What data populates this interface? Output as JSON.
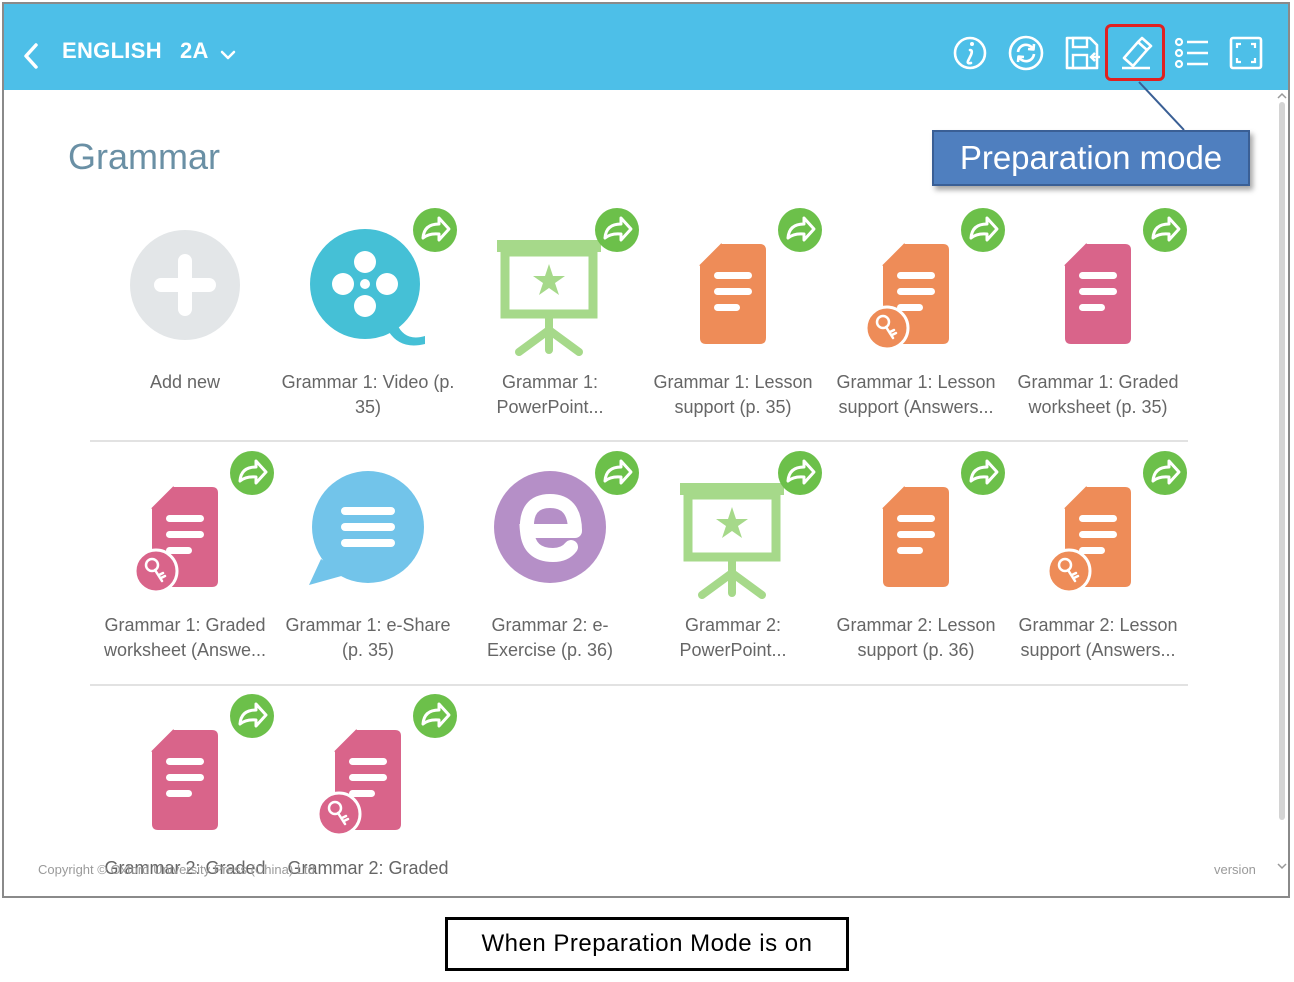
{
  "topbar": {
    "back_icon": "chevron-left-icon",
    "subject": "ENGLISH",
    "grade": "2A",
    "grade_dropdown_icon": "chevron-down-icon",
    "icons": [
      "info-icon",
      "sync-icon",
      "save-icon",
      "preparation-mode-icon",
      "list-icon",
      "fullscreen-icon"
    ],
    "background_color": "#4dbfe8"
  },
  "callout": {
    "text": "Preparation mode",
    "color": "#4f7fbf",
    "highlight_color": "#e02020"
  },
  "section": {
    "title": "Grammar"
  },
  "tiles": [
    {
      "label": "Add new",
      "icon": "add-icon",
      "share": false,
      "key": false
    },
    {
      "label": "Grammar 1: Video (p. 35)",
      "icon": "video-reel-icon",
      "share": true,
      "key": false
    },
    {
      "label": "Grammar 1: PowerPoint...",
      "icon": "presentation-icon",
      "share": true,
      "key": false
    },
    {
      "label": "Grammar 1: Lesson support (p. 35)",
      "icon": "document-icon",
      "share": true,
      "key": false
    },
    {
      "label": "Grammar 1: Lesson support (Answers...",
      "icon": "document-icon",
      "share": true,
      "key": true
    },
    {
      "label": "Grammar 1: Graded worksheet (p. 35)",
      "icon": "document-icon",
      "share": true,
      "key": false
    },
    {
      "label": "Grammar 1: Graded worksheet (Answe...",
      "icon": "document-icon",
      "share": true,
      "key": true
    },
    {
      "label": "Grammar 1: e-Share (p. 35)",
      "icon": "speech-bubble-icon",
      "share": false,
      "key": false
    },
    {
      "label": "Grammar 2: e-Exercise (p. 36)",
      "icon": "e-exercise-icon",
      "share": true,
      "key": false
    },
    {
      "label": "Grammar 2: PowerPoint...",
      "icon": "presentation-icon",
      "share": true,
      "key": false
    },
    {
      "label": "Grammar 2: Lesson support (p. 36)",
      "icon": "document-icon",
      "share": true,
      "key": false
    },
    {
      "label": "Grammar 2: Lesson support (Answers...",
      "icon": "document-icon",
      "share": true,
      "key": true
    },
    {
      "label": "Grammar 2: Graded",
      "icon": "document-icon",
      "share": true,
      "key": false
    },
    {
      "label": "Grammar 2: Graded",
      "icon": "document-icon",
      "share": true,
      "key": true
    }
  ],
  "footer": {
    "copyright": "Copyright © Oxford University Press (China) Ltd",
    "version": "version"
  },
  "caption": "When Preparation Mode is on",
  "colors": {
    "orange": "#ee8c58",
    "pink": "#d9648a",
    "green": "#a6d98a",
    "teal": "#45c0d6",
    "blue": "#72c4ea",
    "purple": "#b58fc7",
    "share": "#6cc04a",
    "gray": "#e3e6e8"
  }
}
